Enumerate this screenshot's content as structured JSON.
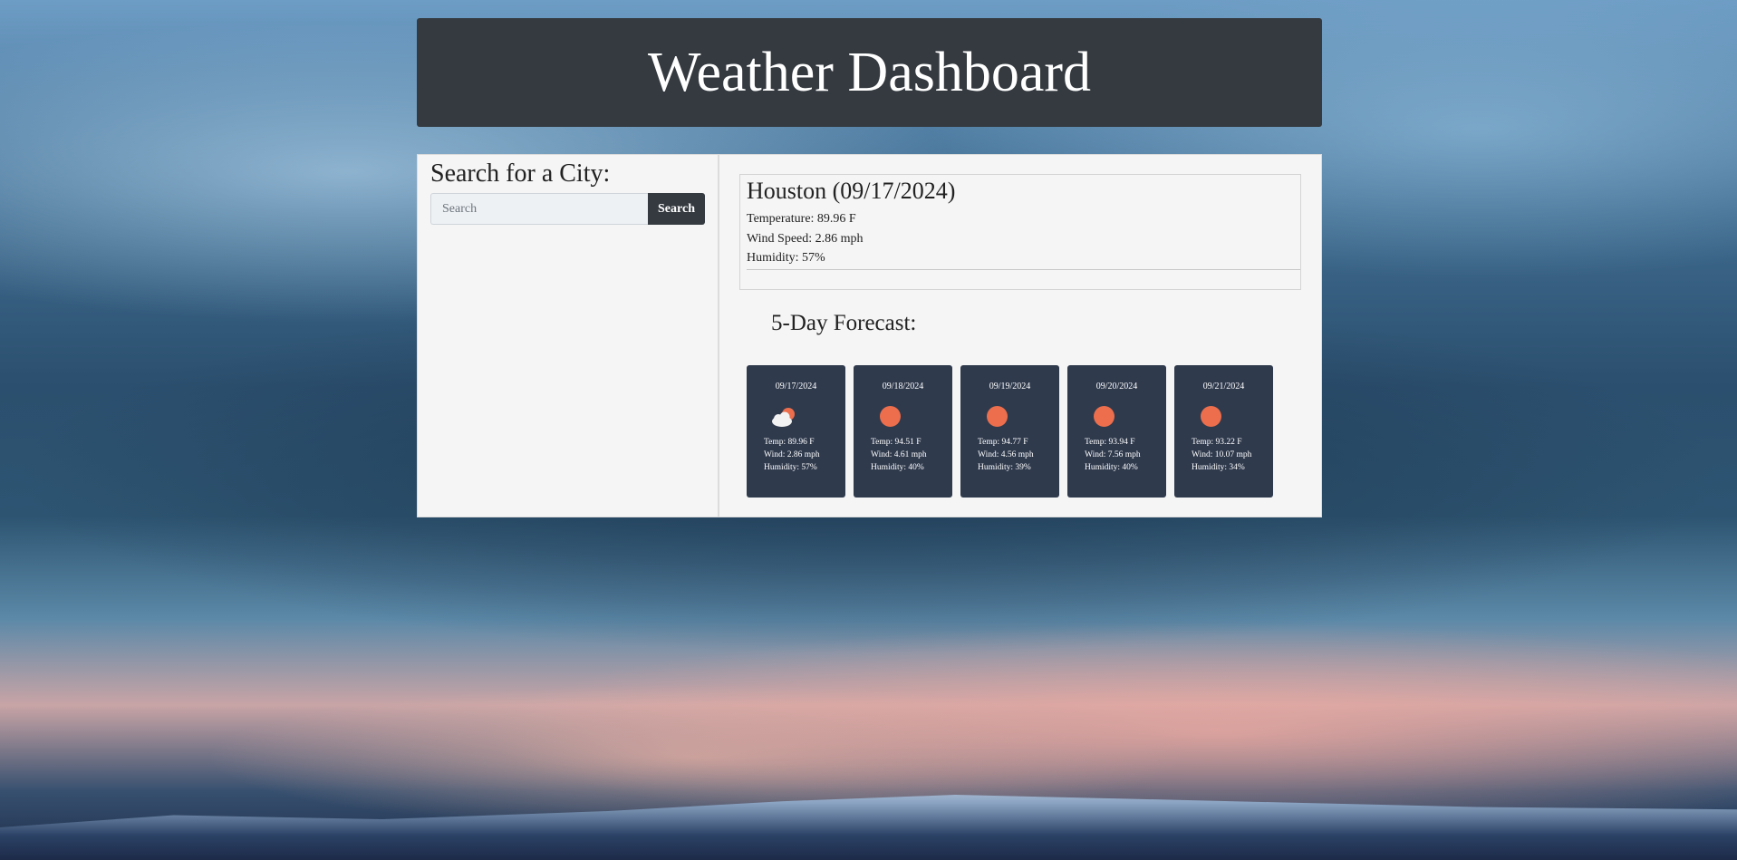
{
  "header": {
    "title": "Weather Dashboard"
  },
  "search": {
    "title": "Search for a City:",
    "placeholder": "Search",
    "button_label": "Search"
  },
  "current": {
    "city_date": "Houston (09/17/2024)",
    "temperature": "Temperature: 89.96 F",
    "wind": "Wind Speed: 2.86 mph",
    "humidity": "Humidity: 57%"
  },
  "forecast": {
    "title": "5-Day Forecast:",
    "days": [
      {
        "date": "09/17/2024",
        "icon": "partly-cloudy-icon",
        "temp": "Temp: 89.96 F",
        "wind": "Wind: 2.86 mph",
        "humidity": "Humidity: 57%"
      },
      {
        "date": "09/18/2024",
        "icon": "sun-icon",
        "temp": "Temp: 94.51 F",
        "wind": "Wind: 4.61 mph",
        "humidity": "Humidity: 40%"
      },
      {
        "date": "09/19/2024",
        "icon": "sun-icon",
        "temp": "Temp: 94.77 F",
        "wind": "Wind: 4.56 mph",
        "humidity": "Humidity: 39%"
      },
      {
        "date": "09/20/2024",
        "icon": "sun-icon",
        "temp": "Temp: 93.94 F",
        "wind": "Wind: 7.56 mph",
        "humidity": "Humidity: 40%"
      },
      {
        "date": "09/21/2024",
        "icon": "sun-icon",
        "temp": "Temp: 93.22 F",
        "wind": "Wind: 10.07 mph",
        "humidity": "Humidity: 34%"
      }
    ]
  },
  "colors": {
    "header_bg": "#343a40",
    "card_bg": "#2f3a4d",
    "sun": "#ec6e4c"
  }
}
